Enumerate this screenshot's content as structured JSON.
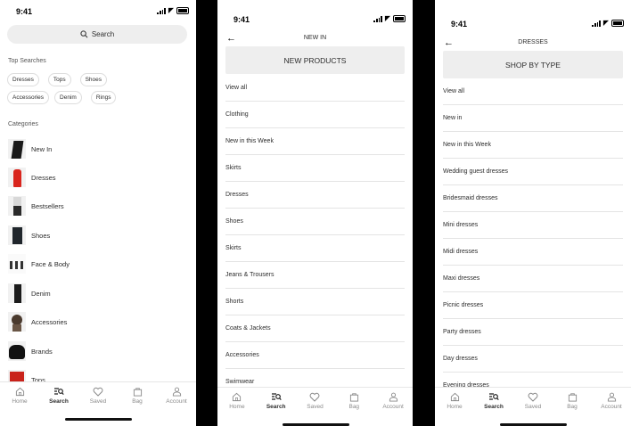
{
  "status": {
    "time": "9:41"
  },
  "screen1": {
    "search_placeholder": "Search",
    "top_searches_label": "Top Searches",
    "top_searches": [
      "Dresses",
      "Tops",
      "Shoes",
      "Accessories",
      "Denim",
      "Rings"
    ],
    "categories_label": "Categories",
    "categories": [
      "New In",
      "Dresses",
      "Bestsellers",
      "Shoes",
      "Face & Body",
      "Denim",
      "Accessories",
      "Brands",
      "Tops"
    ]
  },
  "screen2": {
    "title": "NEW IN",
    "banner": "NEW PRODUCTS",
    "items": [
      "View all",
      "Clothing",
      "New in this Week",
      "Skirts",
      "Dresses",
      "Shoes",
      "Skirts",
      "Jeans & Trousers",
      "Shorts",
      "Coats & Jackets",
      "Accessories",
      "Swimwear"
    ]
  },
  "screen3": {
    "title": "DRESSES",
    "banner": "SHOP BY TYPE",
    "items": [
      "View all",
      "New in",
      "New in this Week",
      "Wedding guest dresses",
      "Bridesmaid dresses",
      "Mini dresses",
      "Midi dresses",
      "Maxi dresses",
      "Picnic dresses",
      "Party dresses",
      "Day dresses",
      "Evening dresses"
    ]
  },
  "tabbar": {
    "items": [
      {
        "label": "Home",
        "icon": "home-icon"
      },
      {
        "label": "Search",
        "icon": "search-icon"
      },
      {
        "label": "Saved",
        "icon": "heart-icon"
      },
      {
        "label": "Bag",
        "icon": "bag-icon"
      },
      {
        "label": "Account",
        "icon": "account-icon"
      }
    ],
    "active": "Search"
  }
}
